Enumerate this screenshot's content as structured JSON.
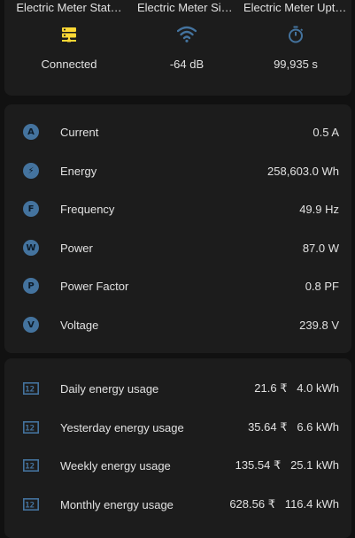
{
  "colors": {
    "background": "#111111",
    "card": "#1c1c1c",
    "icon_blue": "#44739e",
    "icon_yellow": "#fdd835",
    "text": "#e1e1e1"
  },
  "glance": [
    {
      "name": "Electric Meter Stat…",
      "state": "Connected",
      "icon": "server-network-icon"
    },
    {
      "name": "Electric Meter Sign…",
      "state": "-64 dB",
      "icon": "wifi-icon"
    },
    {
      "name": "Electric Meter Upti…",
      "state": "99,935 s",
      "icon": "timer-icon"
    }
  ],
  "sensors": [
    {
      "badge": "A",
      "label": "Current",
      "value": "0.5 A"
    },
    {
      "badge": "⚡",
      "label": "Energy",
      "value": "258,603.0 Wh"
    },
    {
      "badge": "F",
      "label": "Frequency",
      "value": "49.9 Hz"
    },
    {
      "badge": "W",
      "label": "Power",
      "value": "87.0 W"
    },
    {
      "badge": "P",
      "label": "Power Factor",
      "value": "0.8 PF"
    },
    {
      "badge": "V",
      "label": "Voltage",
      "value": "239.8 V"
    }
  ],
  "usage": [
    {
      "label": "Daily energy usage",
      "value": "21.6 ₹   4.0 kWh"
    },
    {
      "label": "Yesterday energy usage",
      "value": "35.64 ₹   6.6 kWh"
    },
    {
      "label": "Weekly energy usage",
      "value": "135.54 ₹   25.1 kWh"
    },
    {
      "label": "Monthly energy usage",
      "value": "628.56 ₹   116.4 kWh"
    }
  ]
}
